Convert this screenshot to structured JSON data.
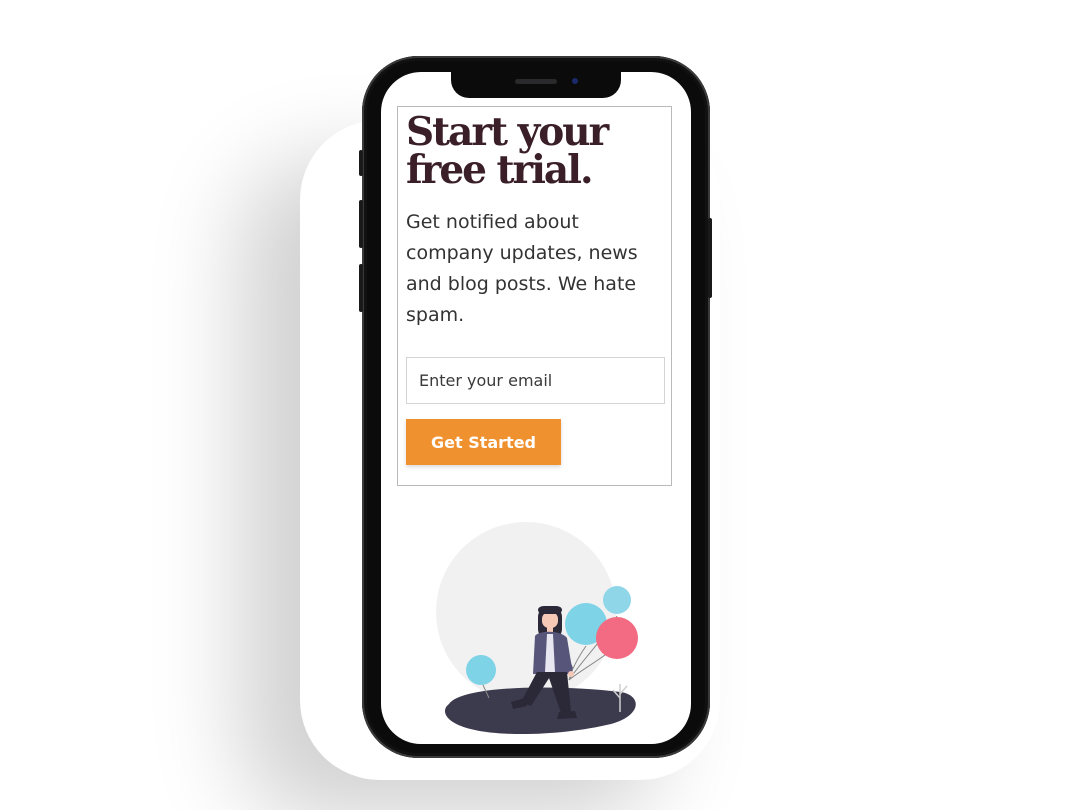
{
  "hero": {
    "headline": "Start your free trial.",
    "subtext": "Get notified about company updates, news and blog posts. We hate spam."
  },
  "signup": {
    "email_placeholder": "Enter your email",
    "button_label": "Get Started"
  },
  "colors": {
    "headline": "#3a1f28",
    "button": "#f0912f",
    "button_text": "#ffffff",
    "balloon_blue": "#7ed3e6",
    "balloon_pink": "#f26b82",
    "ground": "#3c3a4d"
  },
  "illustration": {
    "icon": "woman-with-balloons-illustration"
  }
}
